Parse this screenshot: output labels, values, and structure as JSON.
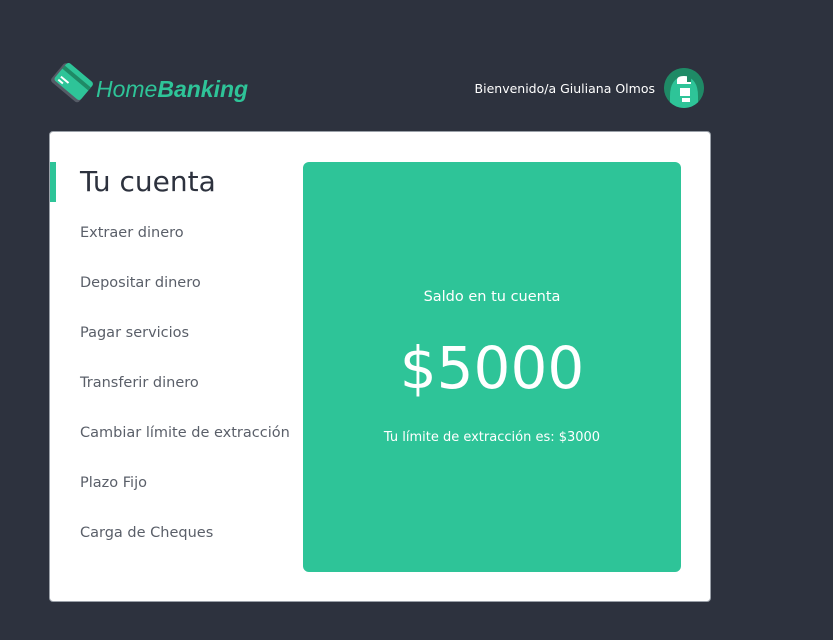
{
  "header": {
    "logo_part1": "Home",
    "logo_part2": "Banking",
    "greeting": "Bienvenido/a Giuliana Olmos"
  },
  "sidebar": {
    "title": "Tu cuenta",
    "items": [
      {
        "label": "Extraer dinero"
      },
      {
        "label": "Depositar dinero"
      },
      {
        "label": "Pagar servicios"
      },
      {
        "label": "Transferir dinero"
      },
      {
        "label": "Cambiar límite de extracción"
      },
      {
        "label": "Plazo Fijo"
      },
      {
        "label": "Carga de Cheques"
      }
    ]
  },
  "balance": {
    "label": "Saldo en tu cuenta",
    "amount": "$5000",
    "limit_text": "Tu límite de extracción es: $3000"
  },
  "colors": {
    "accent": "#2ec498",
    "background": "#2d323e",
    "card": "#ffffff"
  },
  "icons": {
    "logo": "credit-card-icon",
    "avatar": "user-avatar-icon"
  }
}
